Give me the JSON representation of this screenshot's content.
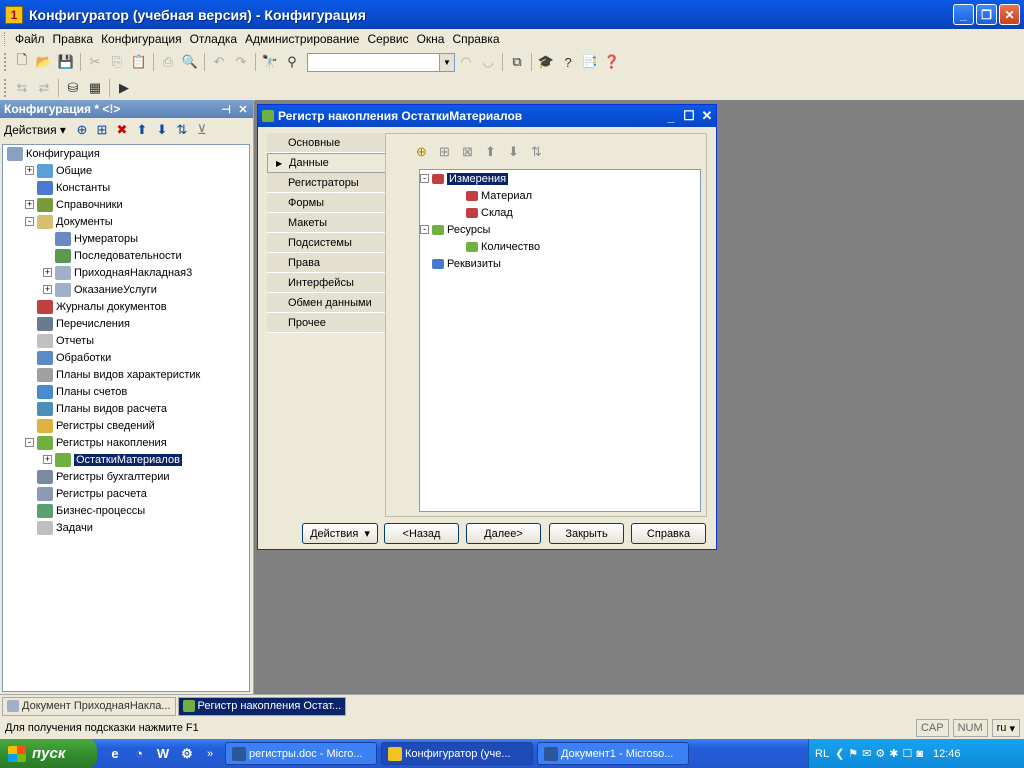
{
  "window": {
    "title": "Конфигуратор (учебная версия) - Конфигурация"
  },
  "menu": [
    "Файл",
    "Правка",
    "Конфигурация",
    "Отладка",
    "Администрирование",
    "Сервис",
    "Окна",
    "Справка"
  ],
  "left_panel": {
    "title": "Конфигурация * <!>",
    "actions_label": "Действия",
    "tree": [
      {
        "label": "Конфигурация",
        "level": 0,
        "expander": "",
        "color": "#8aa0c0"
      },
      {
        "label": "Общие",
        "level": 1,
        "expander": "+",
        "color": "#5aa0d8"
      },
      {
        "label": "Константы",
        "level": 1,
        "expander": "",
        "color": "#4a7ad0"
      },
      {
        "label": "Справочники",
        "level": 1,
        "expander": "+",
        "color": "#7a9a40"
      },
      {
        "label": "Документы",
        "level": 1,
        "expander": "-",
        "color": "#d8c070"
      },
      {
        "label": "Нумераторы",
        "level": 2,
        "expander": "",
        "color": "#6a8ac0"
      },
      {
        "label": "Последовательности",
        "level": 2,
        "expander": "",
        "color": "#5a9a50"
      },
      {
        "label": "ПриходнаяНакладная3",
        "level": 2,
        "expander": "+",
        "color": "#a0b0c8"
      },
      {
        "label": "ОказаниеУслуги",
        "level": 2,
        "expander": "+",
        "color": "#a0b0c8"
      },
      {
        "label": "Журналы документов",
        "level": 1,
        "expander": "",
        "color": "#c04040"
      },
      {
        "label": "Перечисления",
        "level": 1,
        "expander": "",
        "color": "#6a7a90"
      },
      {
        "label": "Отчеты",
        "level": 1,
        "expander": "",
        "color": "#c0c0c0"
      },
      {
        "label": "Обработки",
        "level": 1,
        "expander": "",
        "color": "#5a8ac8"
      },
      {
        "label": "Планы видов характеристик",
        "level": 1,
        "expander": "",
        "color": "#a0a0a0"
      },
      {
        "label": "Планы счетов",
        "level": 1,
        "expander": "",
        "color": "#4a8ad0"
      },
      {
        "label": "Планы видов расчета",
        "level": 1,
        "expander": "",
        "color": "#4a90b8"
      },
      {
        "label": "Регистры сведений",
        "level": 1,
        "expander": "",
        "color": "#e0b040"
      },
      {
        "label": "Регистры накопления",
        "level": 1,
        "expander": "-",
        "color": "#70b040"
      },
      {
        "label": "ОстаткиМатериалов",
        "level": 2,
        "expander": "+",
        "color": "#70b040",
        "selected": true
      },
      {
        "label": "Регистры бухгалтерии",
        "level": 1,
        "expander": "",
        "color": "#7a8aa0"
      },
      {
        "label": "Регистры расчета",
        "level": 1,
        "expander": "",
        "color": "#8a9ab0"
      },
      {
        "label": "Бизнес-процессы",
        "level": 1,
        "expander": "",
        "color": "#5aa070"
      },
      {
        "label": "Задачи",
        "level": 1,
        "expander": "",
        "color": "#c0c0c0"
      }
    ]
  },
  "dialog": {
    "title": "Регистр накопления ОстаткиМатериалов",
    "tabs": [
      "Основные",
      "Данные",
      "Регистраторы",
      "Формы",
      "Макеты",
      "Подсистемы",
      "Права",
      "Интерфейсы",
      "Обмен данными",
      "Прочее"
    ],
    "active_tab": 1,
    "tree": [
      {
        "label": "Измерения",
        "level": 0,
        "expander": "-",
        "selected": true
      },
      {
        "label": "Материал",
        "level": 1,
        "expander": ""
      },
      {
        "label": "Склад",
        "level": 1,
        "expander": ""
      },
      {
        "label": "Ресурсы",
        "level": 0,
        "expander": "-"
      },
      {
        "label": "Количество",
        "level": 1,
        "expander": ""
      },
      {
        "label": "Реквизиты",
        "level": 0,
        "expander": ""
      }
    ],
    "buttons": {
      "actions": "Действия",
      "back": "<Назад",
      "next": "Далее>",
      "close": "Закрыть",
      "help": "Справка"
    }
  },
  "mdi_tabs": [
    {
      "label": "Документ ПриходнаяНакла...",
      "active": false
    },
    {
      "label": "Регистр накопления Остат...",
      "active": true
    }
  ],
  "status": {
    "hint": "Для получения подсказки нажмите F1",
    "cap": "CAP",
    "num": "NUM",
    "lang": "ru"
  },
  "taskbar": {
    "start": "пуск",
    "tasks": [
      {
        "label": "регистры.doc - Micro...",
        "active": false
      },
      {
        "label": "Конфигуратор (уче...",
        "active": true
      },
      {
        "label": "Документ1 - Microso...",
        "active": false
      }
    ],
    "tray_lang": "RL",
    "clock": "12:46"
  }
}
